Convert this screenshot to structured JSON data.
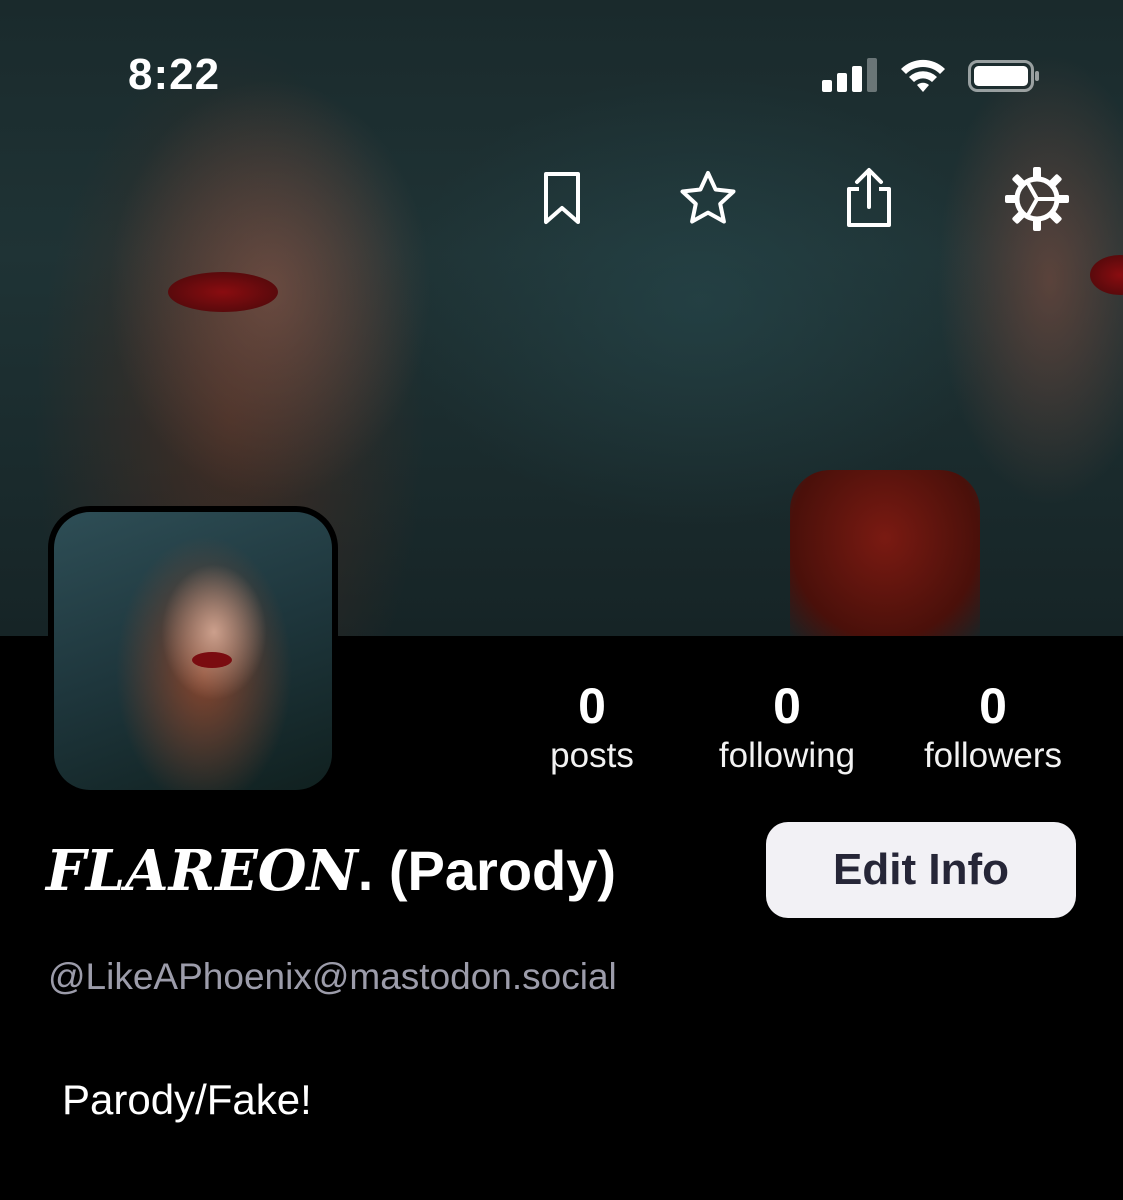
{
  "status_bar": {
    "time": "8:22",
    "icons": [
      "cellular-signal-icon",
      "wifi-icon",
      "battery-icon"
    ]
  },
  "header_actions": [
    "bookmark-icon",
    "star-icon",
    "share-icon",
    "settings-icon"
  ],
  "profile": {
    "display_name_styled": "FLAREON",
    "display_name_rest": ". (Parody)",
    "handle": "@LikeAPhoenix@mastodon.social",
    "bio": "Parody/Fake!"
  },
  "stats": [
    {
      "value": "0",
      "label": "posts"
    },
    {
      "value": "0",
      "label": "following"
    },
    {
      "value": "0",
      "label": "followers"
    }
  ],
  "buttons": {
    "edit_info": "Edit Info"
  },
  "colors": {
    "background": "#000000",
    "button_bg": "#f2f1f5",
    "button_text": "#262637",
    "handle_text": "#9c9caa"
  }
}
